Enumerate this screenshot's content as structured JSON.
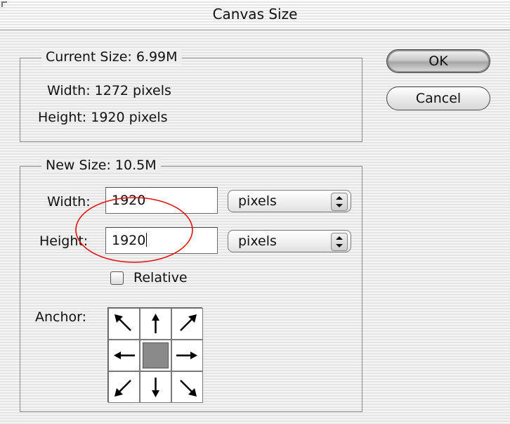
{
  "window": {
    "title": "Canvas Size"
  },
  "current_size": {
    "legend": "Current Size:  6.99M",
    "width_text": "Width: 1272 pixels",
    "height_text": "Height: 1920 pixels"
  },
  "new_size": {
    "legend": "New Size:  10.5M",
    "width_label": "Width:",
    "width_value": "1920",
    "width_unit": "pixels",
    "height_label": "Height:",
    "height_value": "1920",
    "height_unit": "pixels",
    "relative_label": "Relative",
    "relative_checked": false,
    "anchor_label": "Anchor:",
    "anchor_cells": [
      {
        "name": "arrow-up-left-icon"
      },
      {
        "name": "arrow-up-icon"
      },
      {
        "name": "arrow-up-right-icon"
      },
      {
        "name": "arrow-left-icon"
      },
      {
        "name": "anchor-center-icon"
      },
      {
        "name": "arrow-right-icon"
      },
      {
        "name": "arrow-down-left-icon"
      },
      {
        "name": "arrow-down-icon"
      },
      {
        "name": "arrow-down-right-icon"
      }
    ]
  },
  "buttons": {
    "ok_label": "OK",
    "cancel_label": "Cancel"
  },
  "colors": {
    "annotation_circle": "#e01010",
    "anchor_selected": "#8a8a8a"
  }
}
